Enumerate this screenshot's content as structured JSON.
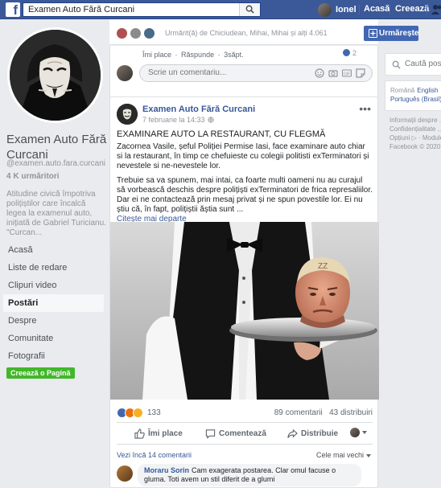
{
  "topbar": {
    "search_value": "Examen Auto Fără Curcani",
    "user_name": "Ionel",
    "home_label": "Acasă",
    "create_label": "Creează"
  },
  "page": {
    "name": "Examen Auto Fără Curcani",
    "handle": "@examen.auto.fara.curcani",
    "followers": "4 K urmăritori",
    "description": "Atitudine civică împotriva polițiștilor care încalcă legea la examenul auto, inițiată de Gabriel Turicianu. \"Curcan..."
  },
  "side_nav": {
    "items": [
      {
        "label": "Acasă",
        "active": false
      },
      {
        "label": "Liste de redare",
        "active": false
      },
      {
        "label": "Clipuri video",
        "active": false
      },
      {
        "label": "Postări",
        "active": true
      },
      {
        "label": "Despre",
        "active": false
      },
      {
        "label": "Comunitate",
        "active": false
      },
      {
        "label": "Fotografii",
        "active": false
      }
    ],
    "create_page": "Creează o Pagină"
  },
  "follow_bar": {
    "text": "Urmărit(ă) de Chiciudean, Mihai, Mihai și alți 4.061",
    "button_label": "Urmărește"
  },
  "prev_comment": {
    "like": "Îmi place",
    "reply": "Răspunde",
    "age": "3săpt.",
    "like_count": "2",
    "input_placeholder": "Scrie un comentariu..."
  },
  "post": {
    "page_name": "Examen Auto Fără Curcani",
    "time": "7 februarie la 14:33",
    "title": "EXAMINARE AUTO LA RESTAURANT, CU FLEGMĂ",
    "paragraph1": "Zacornea Vasile, șeful Poliției Permise Iasi, face examinare auto chiar si la restaurant, în timp ce chefuieste cu colegii politisti exTerminatori și nevestele si ne-nevestele lor.",
    "paragraph2": "Trebuie sa va spunem, mai intai, ca foarte multi oameni nu au curajul să vorbească deschis despre polițiști exTerminatori de frica represaliilor. Dar ei ne contactează prin mesaj privat și ne spun povestile lor. Ei nu știu că, în fapt, polițiștii ăștia sunt ...",
    "see_more": "Citește mai departe",
    "image_caption": "ZZ",
    "reaction_count": "133",
    "comments_count": "89 comentarii",
    "shares_count": "43 distribuiri",
    "actions": {
      "like": "Îmi place",
      "comment": "Comentează",
      "share": "Distribuie"
    },
    "see_previous": "Vezi încă 14 comentarii",
    "sort_label": "Cele mai vechi",
    "last_comment": {
      "author": "Moraru Sorin",
      "text": "Cam exagerata postarea. Clar omul facuse o gluma. Toti avem un stil diferit de a glumi"
    }
  },
  "right": {
    "search_placeholder": "Caută postări",
    "lang_current": "Română",
    "lang_option1": "English",
    "lang_option2": "Português (Brasil)",
    "footer": [
      "Informații despre ...",
      "Confidențialitate ...",
      "Opțiuni ▷ · Module ...",
      "Facebook © 2020"
    ]
  }
}
